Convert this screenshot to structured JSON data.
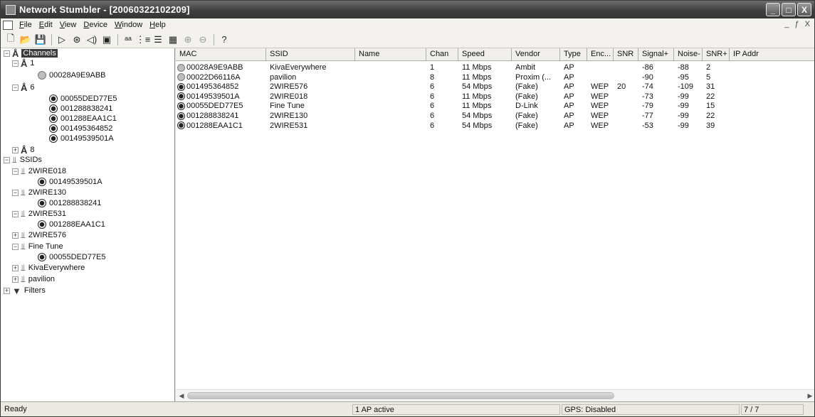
{
  "window": {
    "title": "Network Stumbler - [20060322102209]",
    "buttons": {
      "minimize": "_",
      "maximize": "□",
      "close": "X"
    }
  },
  "menu": {
    "items": [
      "File",
      "Edit",
      "View",
      "Device",
      "Window",
      "Help"
    ],
    "mdi_buttons": [
      "_",
      "ƒ",
      "X"
    ]
  },
  "toolbar": {
    "icons": [
      "new-icon",
      "open-icon",
      "save-icon",
      "play-icon",
      "scan-icon",
      "speaker-icon",
      "properties-icon",
      "sort-icon",
      "tree-icon",
      "list-icon",
      "grid-icon",
      "zoom-in-icon",
      "zoom-out-icon",
      "help-icon"
    ]
  },
  "tree": {
    "channels_label": "Channels",
    "channel_1": {
      "label": "1",
      "children": [
        "00028A9E9ABB"
      ]
    },
    "channel_6": {
      "label": "6",
      "children": [
        "00055DED77E5",
        "001288838241",
        "001288EAA1C1",
        "001495364852",
        "00149539501A"
      ]
    },
    "channel_8": {
      "label": "8"
    },
    "ssids_label": "SSIDs",
    "ssids": [
      {
        "name": "2WIRE018",
        "children": [
          "00149539501A"
        ]
      },
      {
        "name": "2WIRE130",
        "children": [
          "001288838241"
        ]
      },
      {
        "name": "2WIRE531",
        "children": [
          "001288EAA1C1"
        ]
      },
      {
        "name": "2WIRE576",
        "children": []
      },
      {
        "name": "Fine Tune",
        "children": [
          "00055DED77E5"
        ]
      },
      {
        "name": "KivaEverywhere",
        "children": []
      },
      {
        "name": "pavilion",
        "children": []
      }
    ],
    "filters_label": "Filters"
  },
  "list": {
    "columns": [
      "MAC",
      "SSID",
      "Name",
      "Chan",
      "Speed",
      "Vendor",
      "Type",
      "Enc...",
      "SNR",
      "Signal+",
      "Noise-",
      "SNR+",
      "IP Addr"
    ],
    "rows": [
      {
        "mac": "00028A9E9ABB",
        "ssid": "KivaEverywhere",
        "name": "",
        "chan": "1",
        "speed": "11 Mbps",
        "vendor": "Ambit",
        "type": "AP",
        "enc": "",
        "snr": "",
        "signal": "-86",
        "noise": "-88",
        "snrp": "2",
        "ip": "",
        "active": false
      },
      {
        "mac": "00022D66116A",
        "ssid": "pavilion",
        "name": "",
        "chan": "8",
        "speed": "11 Mbps",
        "vendor": "Proxim (...",
        "type": "AP",
        "enc": "",
        "snr": "",
        "signal": "-90",
        "noise": "-95",
        "snrp": "5",
        "ip": "",
        "active": false
      },
      {
        "mac": "001495364852",
        "ssid": "2WIRE576",
        "name": "",
        "chan": "6",
        "speed": "54 Mbps",
        "vendor": "(Fake)",
        "type": "AP",
        "enc": "WEP",
        "snr": "20",
        "signal": "-74",
        "noise": "-109",
        "snrp": "31",
        "ip": "",
        "active": true
      },
      {
        "mac": "00149539501A",
        "ssid": "2WIRE018",
        "name": "",
        "chan": "6",
        "speed": "11 Mbps",
        "vendor": "(Fake)",
        "type": "AP",
        "enc": "WEP",
        "snr": "",
        "signal": "-73",
        "noise": "-99",
        "snrp": "22",
        "ip": "",
        "active": true
      },
      {
        "mac": "00055DED77E5",
        "ssid": "Fine Tune",
        "name": "",
        "chan": "6",
        "speed": "11 Mbps",
        "vendor": "D-Link",
        "type": "AP",
        "enc": "WEP",
        "snr": "",
        "signal": "-79",
        "noise": "-99",
        "snrp": "15",
        "ip": "",
        "active": true
      },
      {
        "mac": "001288838241",
        "ssid": "2WIRE130",
        "name": "",
        "chan": "6",
        "speed": "54 Mbps",
        "vendor": "(Fake)",
        "type": "AP",
        "enc": "WEP",
        "snr": "",
        "signal": "-77",
        "noise": "-99",
        "snrp": "22",
        "ip": "",
        "active": true
      },
      {
        "mac": "001288EAA1C1",
        "ssid": "2WIRE531",
        "name": "",
        "chan": "6",
        "speed": "54 Mbps",
        "vendor": "(Fake)",
        "type": "AP",
        "enc": "WEP",
        "snr": "",
        "signal": "-53",
        "noise": "-99",
        "snrp": "39",
        "ip": "",
        "active": true
      }
    ]
  },
  "status": {
    "left": "Ready",
    "ap_active": "1 AP active",
    "gps": "GPS: Disabled",
    "count": "7 / 7"
  }
}
